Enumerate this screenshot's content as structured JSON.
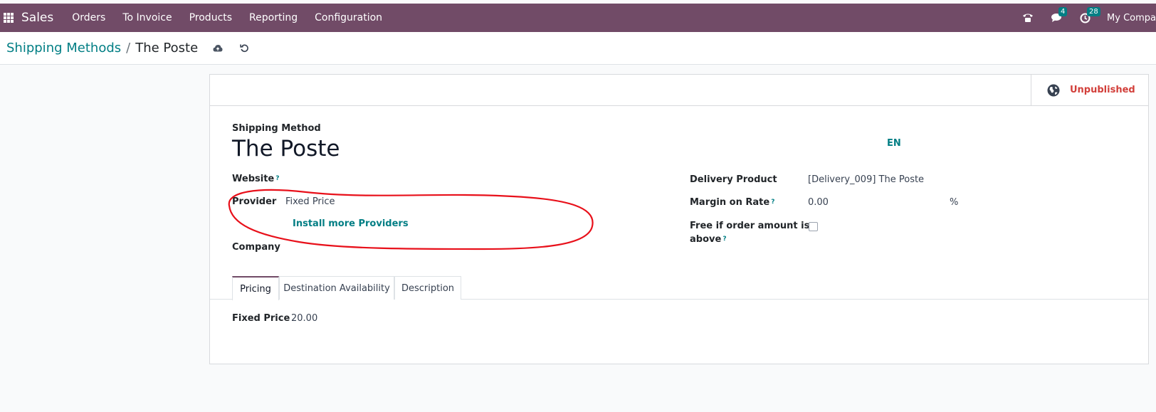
{
  "navbar": {
    "app_name": "Sales",
    "menu": [
      "Orders",
      "To Invoice",
      "Products",
      "Reporting",
      "Configuration"
    ],
    "messages_count": "4",
    "activities_count": "28",
    "company": "My Compa"
  },
  "breadcrumb": {
    "parent": "Shipping Methods",
    "separator": "/",
    "current": "The Poste"
  },
  "publish": {
    "label": "Unpublished",
    "color": "#d23f3a"
  },
  "form": {
    "section_label": "Shipping Method",
    "name": "The Poste",
    "lang": "EN",
    "website_label": "Website",
    "provider_label": "Provider",
    "provider_value": "Fixed Price",
    "install_link": "Install more Providers",
    "company_label": "Company",
    "delivery_product_label": "Delivery Product",
    "delivery_product_value": "[Delivery_009] The Poste",
    "margin_label": "Margin on Rate",
    "margin_value": "0.00",
    "margin_unit": "%",
    "free_label_line1": "Free if order amount is",
    "free_label_line2": "above",
    "help_mark": "?"
  },
  "tabs": [
    "Pricing",
    "Destination Availability",
    "Description"
  ],
  "pricing": {
    "fixed_price_label": "Fixed Price",
    "fixed_price_value": "20.00"
  },
  "colors": {
    "navbar": "#714b67",
    "accent": "#017e84",
    "annotation": "#e8101a"
  },
  "icons": [
    "apps-grid-icon",
    "phone-icon",
    "chat-icon",
    "clock-icon",
    "cloud-save-icon",
    "undo-icon",
    "globe-icon"
  ]
}
